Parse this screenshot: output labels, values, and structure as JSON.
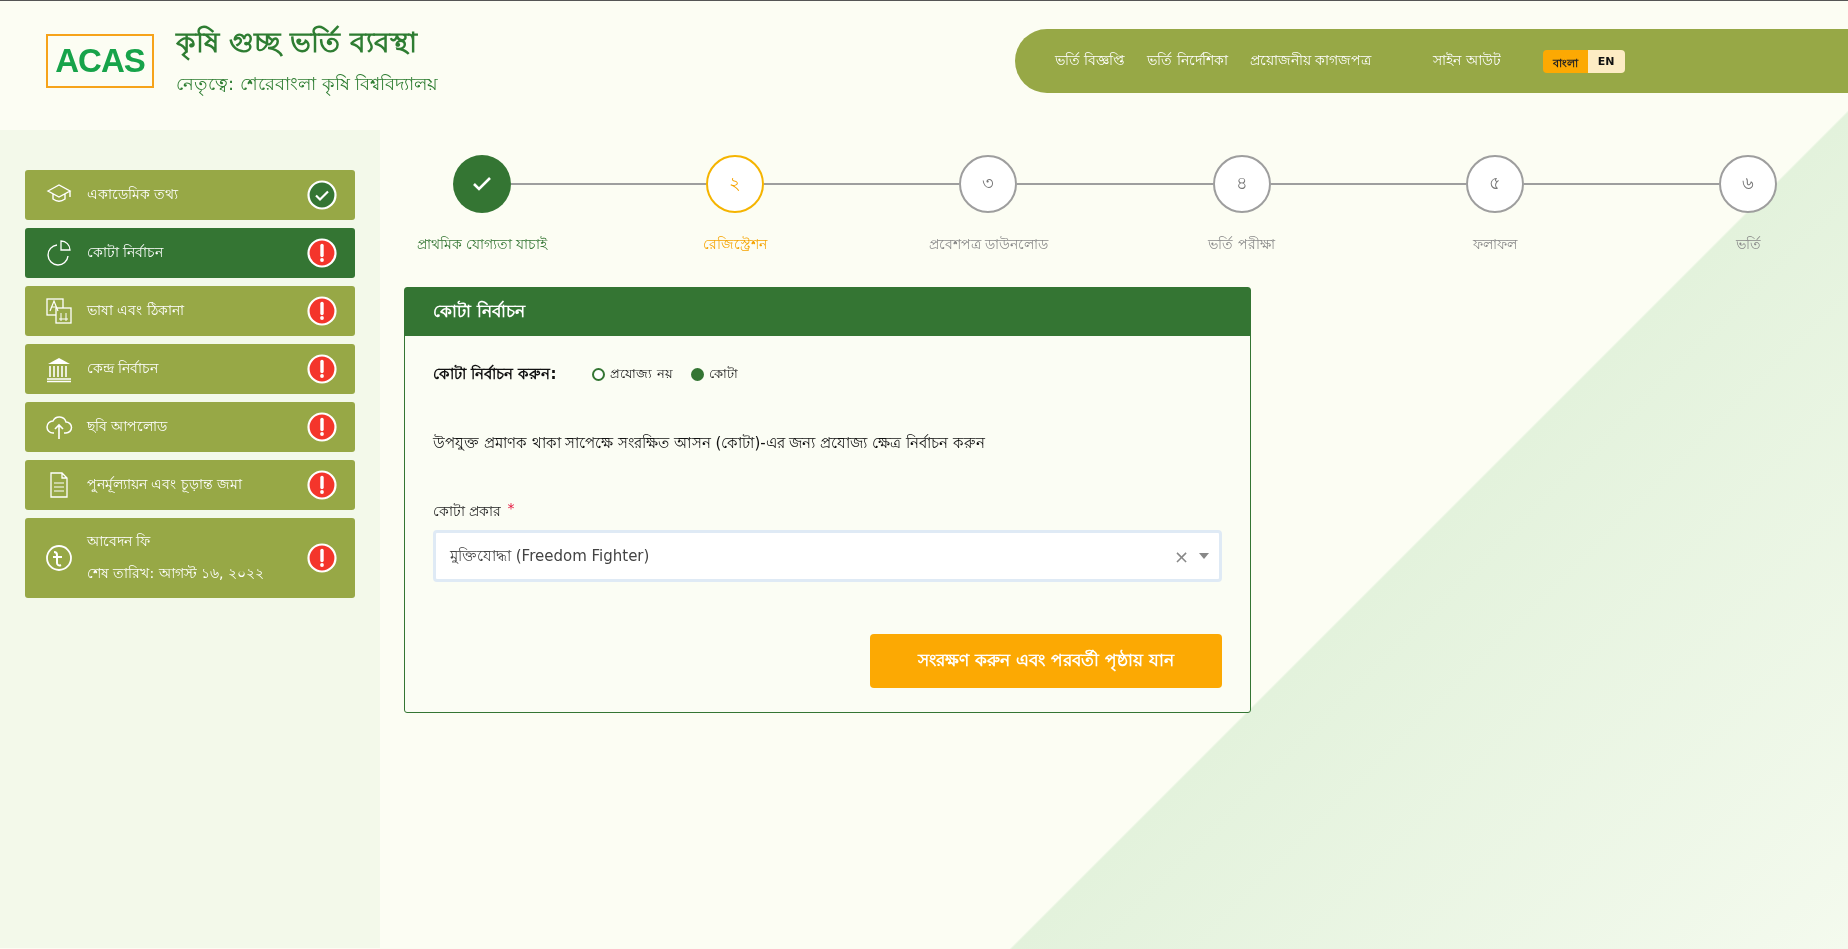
{
  "header": {
    "logo": "ACAS",
    "title": "কৃষি গুচ্ছ ভর্তি ব্যবস্থা",
    "subtitle": "নেতৃত্বে: শেরেবাংলা কৃষি বিশ্ববিদ্যালয়"
  },
  "nav": {
    "links": [
      "ভর্তি বিজ্ঞপ্তি",
      "ভর্তি নির্দেশিকা",
      "প্রয়োজনীয় কাগজপত্র"
    ],
    "sign_out": "সাইন আউট",
    "languages": [
      {
        "label": "বাংলা",
        "selected": true
      },
      {
        "label": "EN",
        "selected": false
      }
    ]
  },
  "sidebar": {
    "items": [
      {
        "kind": "academic",
        "lines": [
          "একাডেমিক তথ্য"
        ],
        "selected": false,
        "complete": true
      },
      {
        "kind": "quota",
        "lines": [
          "কোটা নির্বাচন"
        ],
        "selected": true,
        "complete": false
      },
      {
        "kind": "language",
        "lines": [
          "ভাষা এবং ঠিকানা"
        ],
        "selected": false,
        "complete": false
      },
      {
        "kind": "center",
        "lines": [
          "কেন্দ্র নির্বাচন"
        ],
        "selected": false,
        "complete": false
      },
      {
        "kind": "upload",
        "lines": [
          "ছবি আপলোড"
        ],
        "selected": false,
        "complete": false
      },
      {
        "kind": "review",
        "lines": [
          "পুনর্মূল্যায়ন এবং চূড়ান্ত জমা"
        ],
        "selected": false,
        "complete": false
      },
      {
        "kind": "fee",
        "lines": [
          "আবেদন ফি",
          "শেষ তারিখ: আগস্ট ১৬, ২০২২"
        ],
        "selected": false,
        "complete": false
      }
    ]
  },
  "steps": [
    {
      "label": "প্রাথমিক যোগ্যতা যাচাই",
      "done": true,
      "current": false
    },
    {
      "number": "২",
      "label": "রেজিস্ট্রেশন",
      "done": false,
      "current": true
    },
    {
      "number": "৩",
      "label": "প্রবেশপত্র ডাউনলোড",
      "done": false,
      "current": false
    },
    {
      "number": "৪",
      "label": "ভর্তি পরীক্ষা",
      "done": false,
      "current": false
    },
    {
      "number": "৫",
      "label": "ফলাফল",
      "done": false,
      "current": false
    },
    {
      "number": "৬",
      "label": "ভর্তি",
      "done": false,
      "current": false
    }
  ],
  "card": {
    "title": "কোটা নির্বাচন",
    "choose_label": "কোটা নির্বাচন করুন:",
    "options": [
      {
        "label": "প্রযোজ্য নয়",
        "selected": false
      },
      {
        "label": "কোটা",
        "selected": true
      }
    ],
    "description": "উপযুক্ত প্রমাণক থাকা সাপেক্ষে সংরক্ষিত আসন (কোটা)-এর জন্য প্রযোজ্য ক্ষেত্র নির্বাচন করুন",
    "field_label": "কোটা প্রকার",
    "required_mark": "*",
    "clear_symbol": "×",
    "value": "মুক্তিযোদ্ধা (Freedom Fighter)",
    "submit": "সংরক্ষণ করুন এবং পরবর্তী পৃষ্ঠায় যান"
  }
}
